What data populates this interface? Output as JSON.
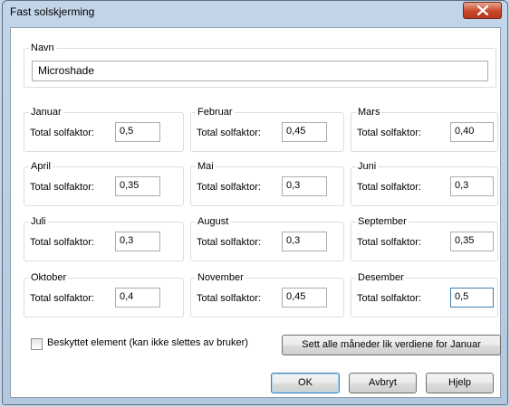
{
  "window": {
    "title": "Fast solskjerming"
  },
  "navn": {
    "legend": "Navn",
    "value": "Microshade"
  },
  "factor_label": "Total solfaktor:",
  "months": [
    {
      "name": "Januar",
      "value": "0,5"
    },
    {
      "name": "Februar",
      "value": "0,45"
    },
    {
      "name": "Mars",
      "value": "0,40"
    },
    {
      "name": "April",
      "value": "0,35"
    },
    {
      "name": "Mai",
      "value": "0,3"
    },
    {
      "name": "Juni",
      "value": "0,3"
    },
    {
      "name": "Juli",
      "value": "0,3"
    },
    {
      "name": "August",
      "value": "0,3"
    },
    {
      "name": "September",
      "value": "0,35"
    },
    {
      "name": "Oktober",
      "value": "0,4"
    },
    {
      "name": "November",
      "value": "0,45"
    },
    {
      "name": "Desember",
      "value": "0,5"
    }
  ],
  "protected": {
    "label": "Beskyttet element (kan ikke slettes av bruker)",
    "checked": false
  },
  "buttons": {
    "set_all": "Sett alle måneder lik verdiene for Januar",
    "ok": "OK",
    "cancel": "Avbryt",
    "help": "Hjelp"
  },
  "icons": {
    "close": "close-icon",
    "checkbox": "checkbox-icon"
  }
}
